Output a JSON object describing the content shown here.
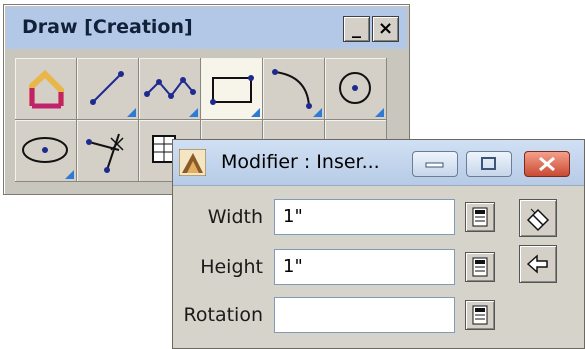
{
  "palette": {
    "title": "Draw [Creation]",
    "minimize_label": "_",
    "close_label": "×",
    "tools": [
      {
        "icon": "cut-corner-icon",
        "has_flyout": false,
        "active": false
      },
      {
        "icon": "line-icon",
        "has_flyout": true,
        "active": false
      },
      {
        "icon": "polyline-icon",
        "has_flyout": true,
        "active": false
      },
      {
        "icon": "rectangle-icon",
        "has_flyout": true,
        "active": true
      },
      {
        "icon": "arc-icon",
        "has_flyout": true,
        "active": false
      },
      {
        "icon": "circle-icon",
        "has_flyout": true,
        "active": false
      },
      {
        "icon": "ellipse-icon",
        "has_flyout": true,
        "active": false
      },
      {
        "icon": "intersection-point-icon",
        "has_flyout": false,
        "active": false
      },
      {
        "icon": "table-icon",
        "has_flyout": false,
        "active": false
      }
    ]
  },
  "dialog": {
    "title": "Modifier : Inser...",
    "fields": [
      {
        "label": "Width",
        "value": "1\""
      },
      {
        "label": "Height",
        "value": "1\""
      },
      {
        "label": "Rotation",
        "value": ""
      }
    ],
    "side_buttons": [
      "eraser-icon",
      "back-arrow-icon"
    ]
  },
  "colors": {
    "palette_title_bg": "#b2c8e6",
    "flyout_indicator": "#2e7bd6",
    "close_button": "#c94a32"
  }
}
